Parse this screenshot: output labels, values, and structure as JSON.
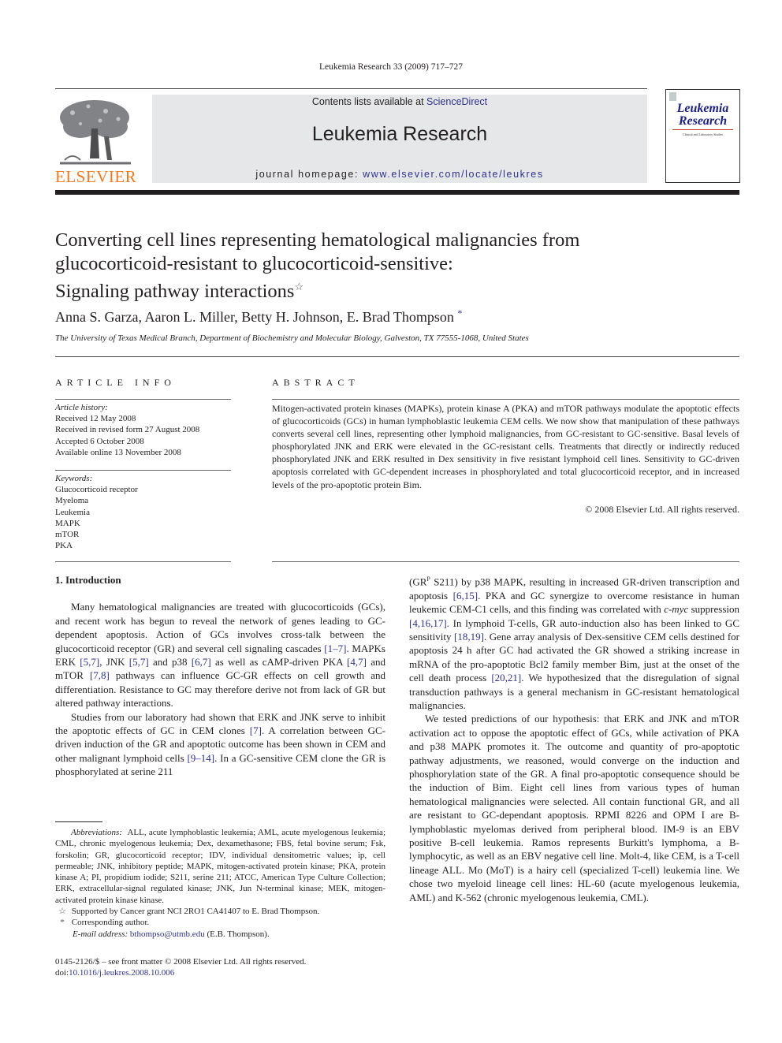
{
  "header": {
    "running_head": "Leukemia Research 33 (2009) 717–727",
    "publisher_logo_text": "ELSEVIER",
    "contents_prefix": "Contents lists available at ",
    "contents_link": "ScienceDirect",
    "journal_title": "Leukemia Research",
    "homepage_prefix": "journal homepage: ",
    "homepage_link": "www.elsevier.com/locate/leukres",
    "cover_title_line1": "Leukemia",
    "cover_title_line2": "Research",
    "cover_subtitle": "Clinical and Laboratory Studies",
    "colors": {
      "elsevier_orange": "#f47920",
      "link_blue": "#2e3192",
      "banner_grey": "#e6e7e8"
    }
  },
  "article": {
    "title_line1": "Converting cell lines representing hematological malignancies from",
    "title_line2": "glucocorticoid-resistant to glucocorticoid-sensitive:",
    "title_line3": "Signaling pathway interactions",
    "title_footnote_mark": "☆",
    "authors": "Anna S. Garza, Aaron L. Miller, Betty H. Johnson, E. Brad Thompson",
    "corresponding_mark": "*",
    "affiliation": "The University of Texas Medical Branch, Department of Biochemistry and Molecular Biology, Galveston, TX 77555-1068, United States"
  },
  "article_info": {
    "heading": "ARTICLE INFO",
    "history_label": "Article history:",
    "history": [
      "Received 12 May 2008",
      "Received in revised form 27 August 2008",
      "Accepted 6 October 2008",
      "Available online 13 November 2008"
    ],
    "keywords_label": "Keywords:",
    "keywords": [
      "Glucocorticoid receptor",
      "Myeloma",
      "Leukemia",
      "MAPK",
      "mTOR",
      "PKA"
    ]
  },
  "abstract": {
    "heading": "ABSTRACT",
    "text": "Mitogen-activated protein kinases (MAPKs), protein kinase A (PKA) and mTOR pathways modulate the apoptotic effects of glucocorticoids (GCs) in human lymphoblastic leukemia CEM cells. We now show that manipulation of these pathways converts several cell lines, representing other lymphoid malignancies, from GC-resistant to GC-sensitive. Basal levels of phosphorylated JNK and ERK were elevated in the GC-resistant cells. Treatments that directly or indirectly reduced phosphorylated JNK and ERK resulted in Dex sensitivity in five resistant lymphoid cell lines. Sensitivity to GC-driven apoptosis correlated with GC-dependent increases in phosphorylated and total glucocorticoid receptor, and in increased levels of the pro-apoptotic protein Bim.",
    "copyright": "© 2008 Elsevier Ltd. All rights reserved."
  },
  "introduction": {
    "heading": "1.  Introduction",
    "p1": [
      {
        "t": "Many hematological malignancies are treated with glucocorticoids (GCs), and recent work has begun to reveal the network of genes leading to GC-dependent apoptosis. Action of GCs involves cross-talk between the glucocorticoid receptor (GR) and several cell signaling cascades "
      },
      {
        "c": "[1–7]"
      },
      {
        "t": ". MAPKs ERK "
      },
      {
        "c": "[5,7]"
      },
      {
        "t": ", JNK "
      },
      {
        "c": "[5,7]"
      },
      {
        "t": " and p38 "
      },
      {
        "c": "[6,7]"
      },
      {
        "t": " as well as cAMP-driven PKA "
      },
      {
        "c": "[4,7]"
      },
      {
        "t": " and mTOR "
      },
      {
        "c": "[7,8]"
      },
      {
        "t": " pathways can influence GC-GR effects on cell growth and differentiation. Resistance to GC may therefore derive not from lack of GR but altered pathway interactions."
      }
    ],
    "p2": [
      {
        "t": "Studies from our laboratory had shown that ERK and JNK serve to inhibit the apoptotic effects of GC in CEM clones "
      },
      {
        "c": "[7]"
      },
      {
        "t": ". A correlation between GC-driven induction of the GR and apoptotic outcome has been shown in CEM and other malignant lymphoid cells "
      },
      {
        "c": "[9–14]"
      },
      {
        "t": ". In a GC-sensitive CEM clone the GR is phosphorylated at serine 211 (GR"
      },
      {
        "sup": "P"
      },
      {
        "t": " S211) by p38 MAPK, resulting in increased GR-driven transcription and apoptosis "
      },
      {
        "c": "[6,15]"
      },
      {
        "t": ". PKA and GC synergize to overcome resistance in human leukemic CEM-C1 cells, and this finding was correlated with "
      },
      {
        "i": "c-myc"
      },
      {
        "t": " suppression "
      },
      {
        "c": "[4,16,17]"
      },
      {
        "t": ". In lymphoid T-cells, GR auto-induction also has been linked to GC sensitivity "
      },
      {
        "c": "[18,19]"
      },
      {
        "t": ". Gene array analysis of Dex-sensitive CEM cells destined for apoptosis 24 h after GC had activated the GR showed a striking increase in mRNA of the pro-apoptotic Bcl2 family member Bim, just at the onset of the cell death process "
      },
      {
        "c": "[20,21]"
      },
      {
        "t": ". We hypothesized that the disregulation of signal transduction pathways is a general mechanism in GC-resistant hematological malignancies."
      }
    ],
    "p3": "We tested predictions of our hypothesis: that ERK and JNK and mTOR activation act to oppose the apoptotic effect of GCs, while activation of PKA and p38 MAPK promotes it. The outcome and quantity of pro-apoptotic pathway adjustments, we reasoned, would converge on the induction and phosphorylation state of the GR. A final pro-apoptotic consequence should be the induction of Bim. Eight cell lines from various types of human hematological malignancies were selected. All contain functional GR, and all are resistant to GC-dependant apoptosis. RPMI 8226 and OPM I are B-lymphoblastic myelomas derived from peripheral blood. IM-9 is an EBV positive B-cell leukemia. Ramos represents Burkitt's lymphoma, a B-lymphocytic, as well as an EBV negative cell line. Molt-4, like CEM, is a T-cell lineage ALL. Mo (MoT) is a hairy cell (specialized T-cell) leukemia line. We chose two myeloid lineage cell lines: HL-60 (acute myelogenous leukemia, AML) and K-562 (chronic myelogenous leukemia, CML)."
  },
  "footnotes": {
    "abbreviations_label": "Abbreviations:",
    "abbreviations": "ALL, acute lymphoblastic leukemia; AML, acute myelogenous leukemia; CML, chronic myelogenous leukemia; Dex, dexamethasone; FBS, fetal bovine serum; Fsk, forskolin; GR, glucocorticoid receptor; IDV, individual densitometric values; ip, cell permeable; JNK, inhibitory peptide; MAPK, mitogen-activated protein kinase; PKA, protein kinase A; PI, propidium iodide; S211, serine 211; ATCC, American Type Culture Collection; ERK, extracellular-signal regulated kinase; JNK, Jun N-terminal kinase; MEK, mitogen-activated protein kinase kinase.",
    "funding_mark": "☆",
    "funding": "Supported by Cancer grant NCI 2RO1 CA41407 to E. Brad Thompson.",
    "corresponding_mark": "*",
    "corresponding": "Corresponding author.",
    "email_label": "E-mail address:",
    "email": "bthompso@utmb.edu",
    "email_suffix": " (E.B. Thompson)."
  },
  "footer": {
    "issn_line": "0145-2126/$ – see front matter © 2008 Elsevier Ltd. All rights reserved.",
    "doi_prefix": "doi:",
    "doi": "10.1016/j.leukres.2008.10.006"
  }
}
